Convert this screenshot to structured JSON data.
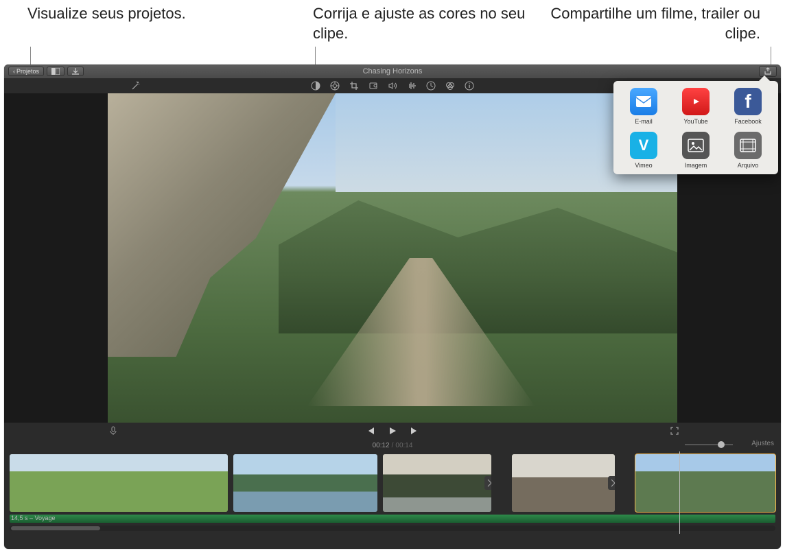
{
  "callouts": {
    "projects": "Visualize seus projetos.",
    "color": "Corrija e ajuste as cores no seu clipe.",
    "share": "Compartilhe um filme, trailer ou clipe."
  },
  "titlebar": {
    "back_label": "Projetos",
    "project_title": "Chasing Horizons"
  },
  "timecode": {
    "current": "00:12",
    "total": "00:14"
  },
  "timeline": {
    "footer_label": "14,5 s – Voyage"
  },
  "settings_label": "Ajustes",
  "share": {
    "items": [
      {
        "label": "E-mail"
      },
      {
        "label": "YouTube"
      },
      {
        "label": "Facebook"
      },
      {
        "label": "Vimeo"
      },
      {
        "label": "Imagem"
      },
      {
        "label": "Arquivo"
      }
    ]
  }
}
